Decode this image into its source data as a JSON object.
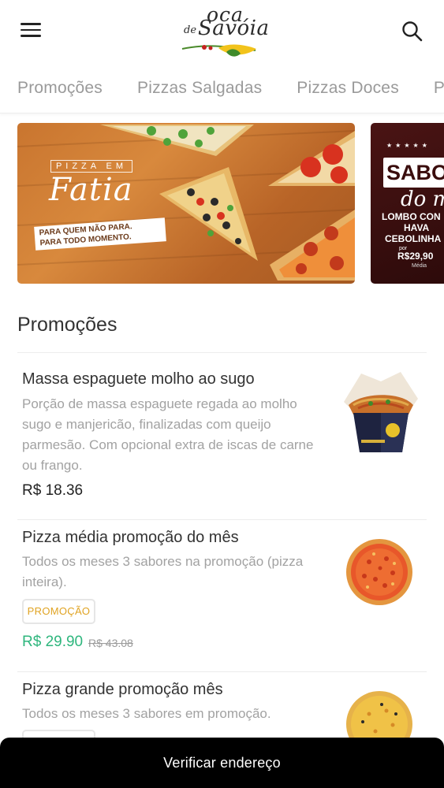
{
  "header": {
    "logo_top": "oca",
    "logo_de": "de",
    "logo_bottom": "Savóia"
  },
  "tabs": [
    {
      "label": "Promoções"
    },
    {
      "label": "Pizzas Salgadas"
    },
    {
      "label": "Pizzas Doces"
    },
    {
      "label": "Pi"
    }
  ],
  "banners": [
    {
      "small_title": "PIZZA EM",
      "title": "Fatia",
      "subtitle_1": "PARA QUEM NÃO PARA.",
      "subtitle_2": "PARA TODO MOMENTO."
    },
    {
      "title_1": "SABO",
      "title_2": "do m",
      "line_1": "LOMBO CON",
      "line_2": "HAVA",
      "line_3": "CEBOLINHA",
      "price_prefix": "por",
      "price": "R$29,90",
      "price_suffix": "Média"
    }
  ],
  "section": {
    "title": "Promoções"
  },
  "products": [
    {
      "name": "Massa espaguete molho ao sugo",
      "description": "Porção de massa espaguete regada ao molho sugo e manjericão, finalizadas com queijo parmesão. Com opcional extra de iscas de carne ou frango.",
      "price": "R$ 18.36"
    },
    {
      "name": "Pizza média promoção do mês",
      "description": "Todos os meses 3 sabores na promoção (pizza inteira).",
      "badge": "PROMOÇÃO",
      "price": "R$ 29.90",
      "old_price": "R$ 43.08"
    },
    {
      "name": "Pizza grande promoção mês",
      "description": "Todos os meses 3 sabores em promoção."
    }
  ],
  "bottom_bar": {
    "label": "Verificar endereço"
  },
  "colors": {
    "promo_price": "#2eb67d",
    "badge_text": "#e0a322",
    "bottom_bar": "#000000"
  }
}
